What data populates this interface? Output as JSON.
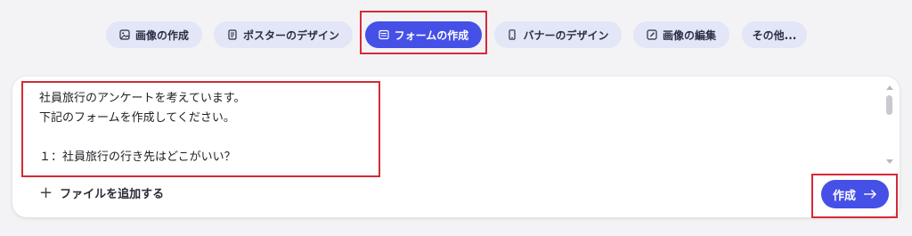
{
  "chips": [
    {
      "label": "画像の作成",
      "icon": "image-icon",
      "active": false
    },
    {
      "label": "ポスターのデザイン",
      "icon": "document-icon",
      "active": false
    },
    {
      "label": "フォームの作成",
      "icon": "form-icon",
      "active": true
    },
    {
      "label": "バナーのデザイン",
      "icon": "phone-icon",
      "active": false
    },
    {
      "label": "画像の編集",
      "icon": "image-edit-icon",
      "active": false
    },
    {
      "label": "その他...",
      "icon": "",
      "active": false
    }
  ],
  "prompt": {
    "text": "社員旅行のアンケートを考えています。\n下記のフォームを作成してください。\n\n１：社員旅行の行き先はどこがいい？"
  },
  "composer": {
    "add_file_label": "ファイルを追加する",
    "create_label": "作成"
  },
  "colors": {
    "accent": "#4550e6",
    "chip_bg": "#e2e6f6",
    "highlight": "#d42b36",
    "background": "#f3f3f6"
  }
}
